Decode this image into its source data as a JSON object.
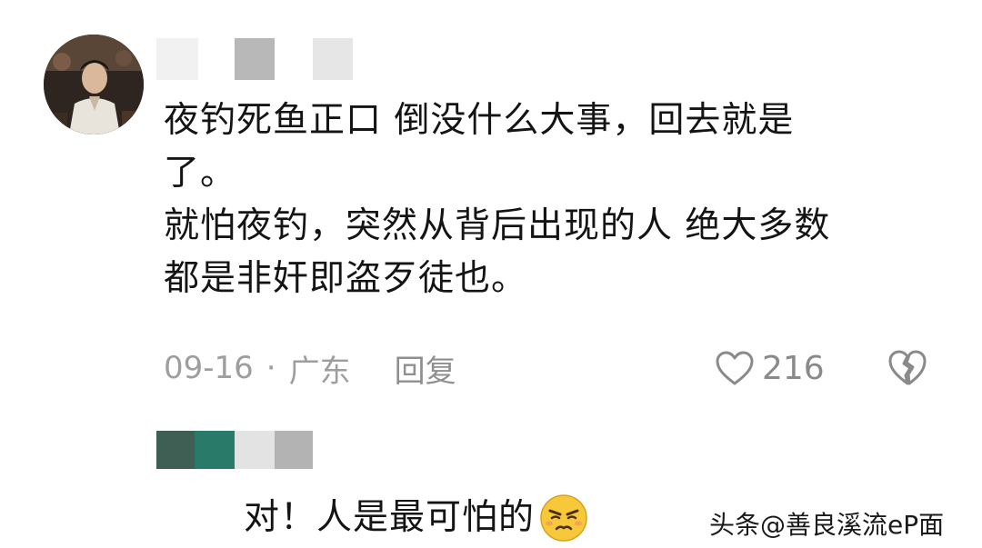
{
  "comment": {
    "text_lines": [
      "夜钓死鱼正口 倒没什么大事，回去就是",
      "了。",
      "就怕夜钓，突然从背后出现的人 绝大多数",
      "都是非奸即盗歹徒也。"
    ],
    "meta": {
      "date": "09-16",
      "separator": "·",
      "location": "广东",
      "reply_label": "回复"
    },
    "like_count": "216",
    "like_icon": "heart-outline-icon",
    "dislike_icon": "broken-heart-icon"
  },
  "reply": {
    "text": "对！人是最可怕的",
    "emoji": "frowning-face-emoji-icon"
  },
  "watermark": {
    "text": "头条@善良溪流eP面"
  },
  "colors": {
    "text": "#141414",
    "meta_gray": "#9e9e9e",
    "username_blocks": [
      "#f1f1f1",
      "#b8b8b8",
      "#e6e6e6"
    ],
    "reply_username_blocks": [
      "#3f5f55",
      "#2a7a6a",
      "#e3e3e3",
      "#b3b3b3"
    ],
    "emoji_yellow": "#f6c83a"
  }
}
